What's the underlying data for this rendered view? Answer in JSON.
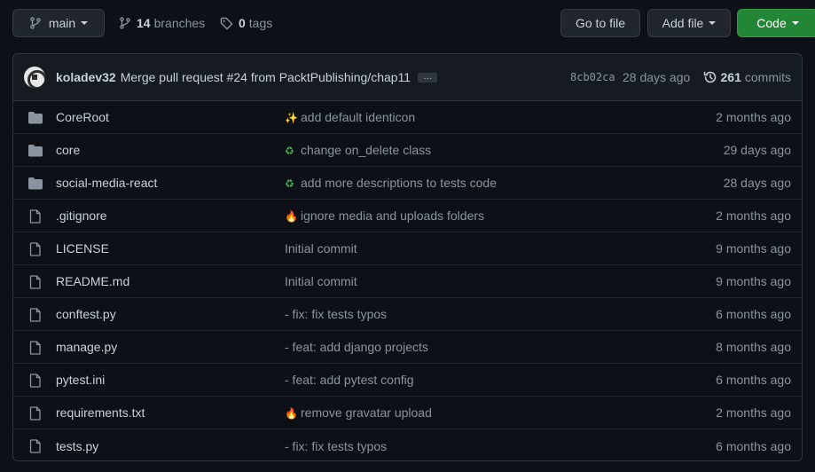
{
  "toolbar": {
    "branch_label": "main",
    "branches_count": "14",
    "branches_label": "branches",
    "tags_count": "0",
    "tags_label": "tags",
    "goto_file_label": "Go to file",
    "add_file_label": "Add file",
    "code_label": "Code"
  },
  "latest_commit": {
    "author": "koladev32",
    "message_before": "Merge pull request",
    "pr_ref": "#24",
    "message_after": "from PacktPublishing/chap11",
    "ellipsis": "…",
    "sha": "8cb02ca",
    "time": "28 days ago",
    "commits_count": "261",
    "commits_label": "commits"
  },
  "files": [
    {
      "type": "folder",
      "name": "CoreRoot",
      "emoji": "✨",
      "emoji_color": "#e3b341",
      "message": "add default identicon",
      "date": "2 months ago"
    },
    {
      "type": "folder",
      "name": "core",
      "emoji": "♻",
      "emoji_color": "#3fb950",
      "message": "change on_delete class",
      "date": "29 days ago"
    },
    {
      "type": "folder",
      "name": "social-media-react",
      "emoji": "♻",
      "emoji_color": "#3fb950",
      "message": "add more descriptions to tests code",
      "date": "28 days ago"
    },
    {
      "type": "file",
      "name": ".gitignore",
      "emoji": "🔥",
      "emoji_color": "#f0883e",
      "message": "ignore media and uploads folders",
      "date": "2 months ago"
    },
    {
      "type": "file",
      "name": "LICENSE",
      "emoji": "",
      "emoji_color": "",
      "message": "Initial commit",
      "date": "9 months ago"
    },
    {
      "type": "file",
      "name": "README.md",
      "emoji": "",
      "emoji_color": "",
      "message": "Initial commit",
      "date": "9 months ago"
    },
    {
      "type": "file",
      "name": "conftest.py",
      "emoji": "",
      "emoji_color": "",
      "message": "- fix: fix tests typos",
      "date": "6 months ago"
    },
    {
      "type": "file",
      "name": "manage.py",
      "emoji": "",
      "emoji_color": "",
      "message": "- feat: add django projects",
      "date": "8 months ago"
    },
    {
      "type": "file",
      "name": "pytest.ini",
      "emoji": "",
      "emoji_color": "",
      "message": "- feat: add pytest config",
      "date": "6 months ago"
    },
    {
      "type": "file",
      "name": "requirements.txt",
      "emoji": "🔥",
      "emoji_color": "#f0883e",
      "message": "remove gravatar upload",
      "date": "2 months ago"
    },
    {
      "type": "file",
      "name": "tests.py",
      "emoji": "",
      "emoji_color": "",
      "message": "- fix: fix tests typos",
      "date": "6 months ago"
    }
  ],
  "colors": {
    "background": "#0d1117",
    "border": "#30363d",
    "text": "#c9d1d9",
    "muted": "#8b949e",
    "code_button": "#238636",
    "folder_icon": "#8b949e"
  }
}
